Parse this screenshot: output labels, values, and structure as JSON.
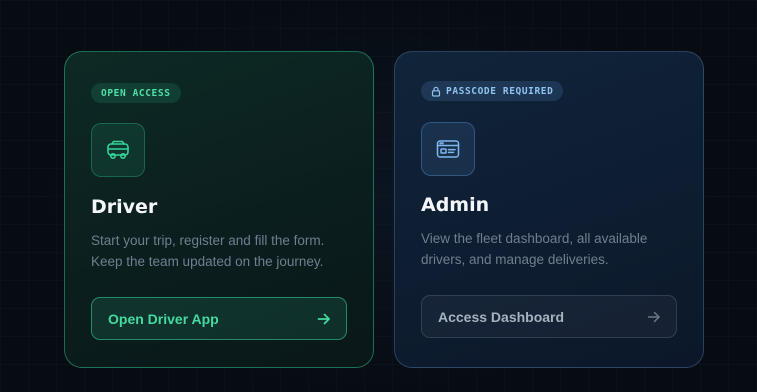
{
  "cards": {
    "driver": {
      "badge": "OPEN ACCESS",
      "icon": "van-icon",
      "title": "Driver",
      "description_lines": [
        "Start your trip, register and fill the form.",
        "Keep the team updated on the journey."
      ],
      "button_label": "Open Driver App",
      "accent_color": "#34d399"
    },
    "admin": {
      "badge": "PASSCODE REQUIRED",
      "badge_icon": "lock-icon",
      "icon": "dashboard-window-icon",
      "title": "Admin",
      "description_lines": [
        "View the fleet dashboard, all available",
        "drivers, and manage deliveries."
      ],
      "button_label": "Access Dashboard",
      "accent_color": "#7fb8ee"
    }
  },
  "colors": {
    "background": "#070b12",
    "driver_card": "#0d2a25",
    "admin_card": "#10243a"
  }
}
